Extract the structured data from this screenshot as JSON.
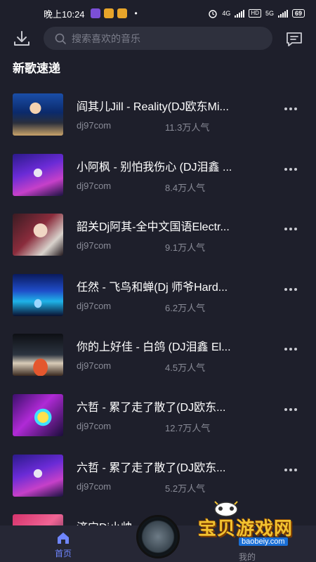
{
  "status_bar": {
    "time": "晚上10:24",
    "network_1": "4G",
    "hd": "HD",
    "network_2": "5G",
    "battery": "69"
  },
  "search": {
    "placeholder": "搜索喜欢的音乐"
  },
  "section_title": "新歌速递",
  "songs": [
    {
      "title": "阎其儿Jill - Reality(DJ欧东Mi...",
      "source": "dj97com",
      "popularity": "11.3万人气"
    },
    {
      "title": "小阿枫 - 别怕我伤心 (DJ泪鑫 ...",
      "source": "dj97com",
      "popularity": "8.4万人气"
    },
    {
      "title": "韶关Dj阿其-全中文国语Electr...",
      "source": "dj97com",
      "popularity": "9.1万人气"
    },
    {
      "title": "任然 - 飞鸟和蝉(Dj 师爷Hard...",
      "source": "dj97com",
      "popularity": "6.2万人气"
    },
    {
      "title": "你的上好佳 - 白鸽 (DJ泪鑫 El...",
      "source": "dj97com",
      "popularity": "4.5万人气"
    },
    {
      "title": "六哲 - 累了走了散了(DJ欧东...",
      "source": "dj97com",
      "popularity": "12.7万人气"
    },
    {
      "title": "六哲 - 累了走了散了(DJ欧东...",
      "source": "dj97com",
      "popularity": "5.2万人气"
    },
    {
      "title": "济宁Dj小帅...",
      "source": "",
      "popularity": ""
    }
  ],
  "bottom_nav": {
    "home_label": "首页",
    "mine_label": "我的"
  },
  "watermark": {
    "text": "宝贝游戏网",
    "url": "baobeiy.com"
  },
  "colors": {
    "background": "#1e1f2b",
    "accent": "#6f86ff",
    "watermark_gold": "#f2c230"
  }
}
